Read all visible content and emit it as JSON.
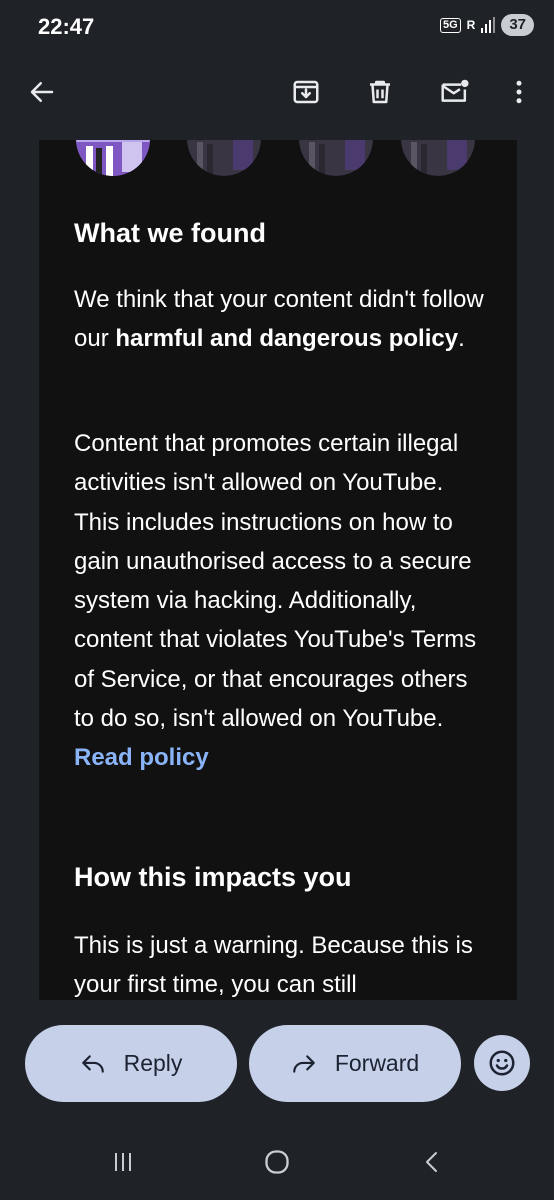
{
  "status_bar": {
    "time": "22:47",
    "network": "5G",
    "roaming": "R",
    "battery": "37"
  },
  "app_bar": {
    "icons": [
      "back-arrow-icon",
      "archive-icon",
      "delete-icon",
      "mark-unread-icon",
      "more-vertical-icon"
    ]
  },
  "email": {
    "found_heading": "What we found",
    "found_text_1": "We think that your content didn't follow our ",
    "found_text_bold": "harmful and dangerous policy",
    "found_text_end": ".",
    "policy_text": "Content that promotes certain illegal activities isn't allowed on YouTube. This includes instructions on how to gain unauthorised access to a secure system via hacking. Additionally, content that violates YouTube's Terms of Service, or that encourages others to do so, isn't allowed on YouTube. ",
    "policy_link": "Read policy",
    "impact_heading": "How this impacts you",
    "impact_text": "This is just a warning. Because this is your first time, you can still"
  },
  "actions": {
    "reply_label": "Reply",
    "forward_label": "Forward"
  },
  "colors": {
    "link": "#8ab4f8",
    "pill": "#c6d0e9",
    "background": "#1f2227",
    "email_bg": "#111111"
  }
}
